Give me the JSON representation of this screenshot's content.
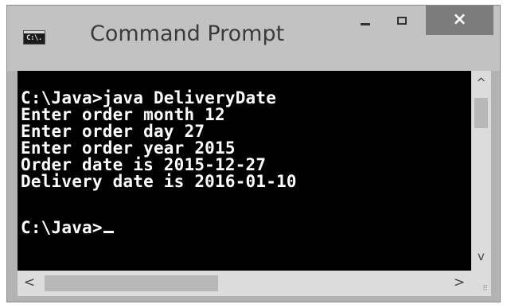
{
  "window": {
    "title": "Command Prompt",
    "icon": "C:\\.",
    "controls": {
      "minimize": "minimize-icon",
      "maximize": "maximize-icon",
      "close": "×"
    }
  },
  "console": {
    "lines": [
      "C:\\Java>java DeliveryDate",
      "Enter order month 12",
      "Enter order day 27",
      "Enter order year 2015",
      "Order date is 2015-12-27",
      "Delivery date is 2016-01-10",
      "",
      "C:\\Java>"
    ],
    "colors": {
      "background": "#000000",
      "text": "#ffffff"
    }
  },
  "scrollbars": {
    "up_arrow": "^",
    "down_arrow": "v",
    "left_arrow": "<",
    "right_arrow": ">"
  }
}
